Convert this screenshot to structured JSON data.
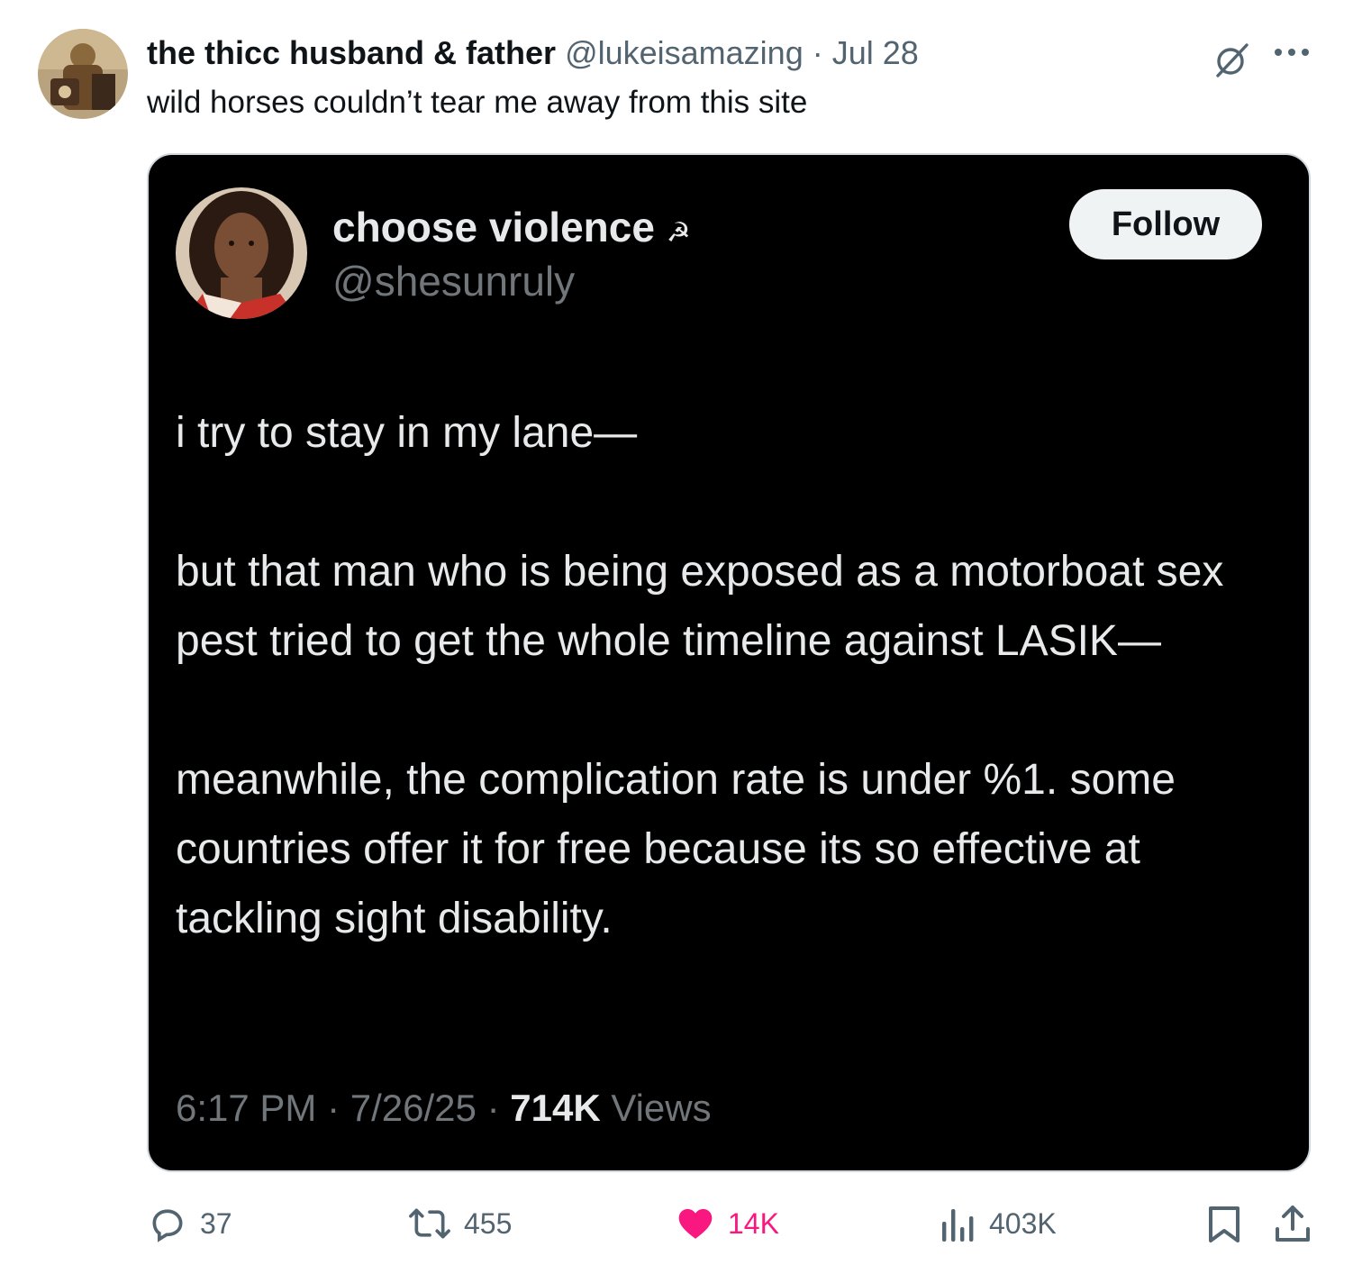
{
  "author": {
    "display_name": "the thicc husband & father",
    "handle": "@lukeisamazing",
    "separator": "·",
    "date": "Jul 28"
  },
  "tweet_text": "wild horses couldn’t tear me away from this site",
  "quoted": {
    "display_name": "choose violence",
    "name_emoji": "☭",
    "handle": "@shesunruly",
    "follow_label": "Follow",
    "paragraphs": [
      "i try to stay in my lane—",
      "but that man who is being exposed as a motorboat sex pest tried to get the whole timeline against LASIK—",
      "meanwhile, the complication rate is under %1. some countries offer it for free because its so effective at tackling sight disability."
    ],
    "time": "6:17 PM",
    "sep1": "·",
    "date": "7/26/25",
    "sep2": "·",
    "views_count": "714K",
    "views_label": "Views"
  },
  "actions": {
    "replies": "37",
    "reposts": "455",
    "likes": "14K",
    "views": "403K"
  },
  "colors": {
    "like_pink": "#f91880",
    "muted": "#536471",
    "quote_bg": "#000000"
  }
}
